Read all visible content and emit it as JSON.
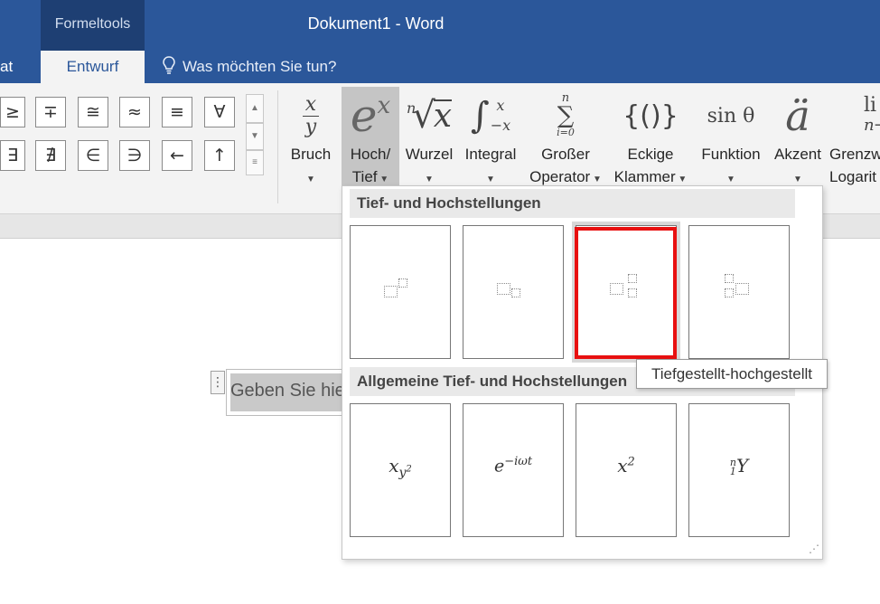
{
  "window": {
    "title": "Dokument1 - Word",
    "context_group": "Formeltools"
  },
  "tabs": {
    "cut_tab": "at",
    "active_tab": "Entwurf"
  },
  "tell_me": {
    "text": "Was möchten Sie tun?"
  },
  "symbols": {
    "row1": [
      "≥",
      "∓",
      "≅",
      "≈",
      "≡",
      "∀"
    ],
    "row2": [
      "∃",
      "∄",
      "∈",
      "∋",
      "←",
      "↑"
    ]
  },
  "ribbon_buttons": [
    {
      "id": "bruch",
      "line1": "Bruch",
      "line2": ""
    },
    {
      "id": "hochtief",
      "line1": "Hoch/",
      "line2": "Tief"
    },
    {
      "id": "wurzel",
      "line1": "Wurzel",
      "line2": ""
    },
    {
      "id": "integral",
      "line1": "Integral",
      "line2": ""
    },
    {
      "id": "operator",
      "line1": "Großer",
      "line2": "Operator"
    },
    {
      "id": "klammer",
      "line1": "Eckige",
      "line2": "Klammer"
    },
    {
      "id": "funktion",
      "line1": "Funktion",
      "line2": ""
    },
    {
      "id": "akzent",
      "line1": "Akzent",
      "line2": ""
    },
    {
      "id": "grenzwert",
      "line1": "Grenzw",
      "line2": "Logarit"
    }
  ],
  "ribbon_icons": {
    "bruch_num": "x",
    "bruch_den": "y",
    "hochtief_base": "e",
    "hochtief_sup": "x",
    "wurzel_index": "n",
    "wurzel_radicand": "x",
    "integral_sign": "∫",
    "integral_upper": "x",
    "integral_lower": "−x",
    "operator_sign": "∑",
    "operator_upper": "n",
    "operator_lower": "i=0",
    "klammer_text": "{()}",
    "funktion_text": "sin θ",
    "akzent_text": "ä",
    "grenzwert_top": "li",
    "grenzwert_bottom": "n→"
  },
  "document": {
    "equation_placeholder": "Geben Sie hie"
  },
  "dropdown": {
    "section1_title": "Tief- und Hochstellungen",
    "section2_title": "Allgemeine Tief- und Hochstellungen",
    "tooltip": "Tiefgestellt-hochgestellt",
    "general_items": [
      {
        "base": "x",
        "sub": "y",
        "subsup": "2"
      },
      {
        "base": "e",
        "sup": "−iωt"
      },
      {
        "base": "x",
        "sup": "2"
      },
      {
        "pre_sup": "n",
        "pre_sub": "1",
        "base": "Y"
      }
    ]
  },
  "colors": {
    "title_bar": "#2b579a",
    "context_group": "#1e3f73",
    "highlight": "#e81010"
  }
}
